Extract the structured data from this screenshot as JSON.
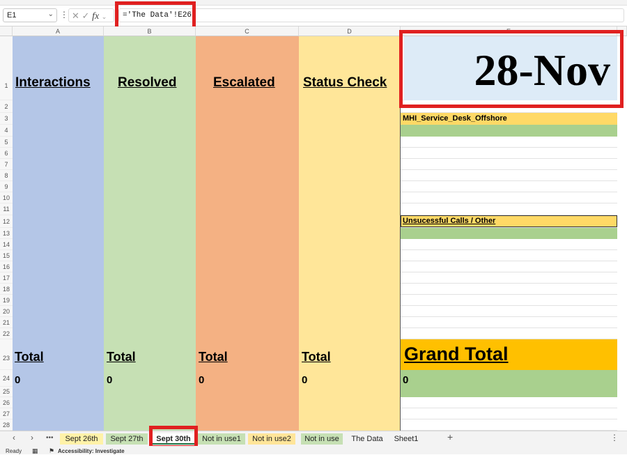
{
  "formula_bar": {
    "name_box": "E1",
    "formula": "='The Data'!E26",
    "fx_label": "fx"
  },
  "columns": [
    "A",
    "B",
    "C",
    "D",
    "E"
  ],
  "rows": [
    "1",
    "2",
    "3",
    "4",
    "5",
    "6",
    "7",
    "8",
    "9",
    "10",
    "11",
    "12",
    "13",
    "14",
    "15",
    "16",
    "17",
    "18",
    "19",
    "20",
    "21",
    "22",
    "23",
    "24",
    "25",
    "26",
    "27",
    "28"
  ],
  "headers": {
    "a": "Interactions",
    "b": "Resolved",
    "c": "Escalated",
    "d": "Status Check",
    "e": "28-Nov"
  },
  "sections": {
    "service_desk": "MHI_Service_Desk_Offshore",
    "unsuccessful": "Unsucessful Calls / Other"
  },
  "totals": {
    "label": "Total",
    "grand_label": "Grand Total",
    "a": "0",
    "b": "0",
    "c": "0",
    "d": "0",
    "grand": "0"
  },
  "sheet_tabs": [
    {
      "label": "Sept 26th",
      "color": "#fff2a8"
    },
    {
      "label": "Sept 27th",
      "color": "#c6e0b4"
    },
    {
      "label": "Sept 30th",
      "color": "#ffffff",
      "active": true
    },
    {
      "label": "Not in use1",
      "color": "#c6e0b4"
    },
    {
      "label": "Not in use2",
      "color": "#ffe599"
    },
    {
      "label": "Not in use",
      "color": "#c6e0b4"
    },
    {
      "label": "The Data",
      "color": "#f3f3f3"
    },
    {
      "label": "Sheet1",
      "color": "#f3f3f3"
    }
  ],
  "status": {
    "ready": "Ready",
    "accessibility": "Accessibility: Investigate"
  },
  "colors": {
    "col_a": "#b4c6e7",
    "col_b": "#c6e0b4",
    "col_c": "#f4b183",
    "col_d": "#ffe699",
    "date_cell": "#ddebf7",
    "yellow": "#ffd966",
    "green": "#a9d08e",
    "grand_total": "#ffc000",
    "highlight": "#e02020"
  }
}
